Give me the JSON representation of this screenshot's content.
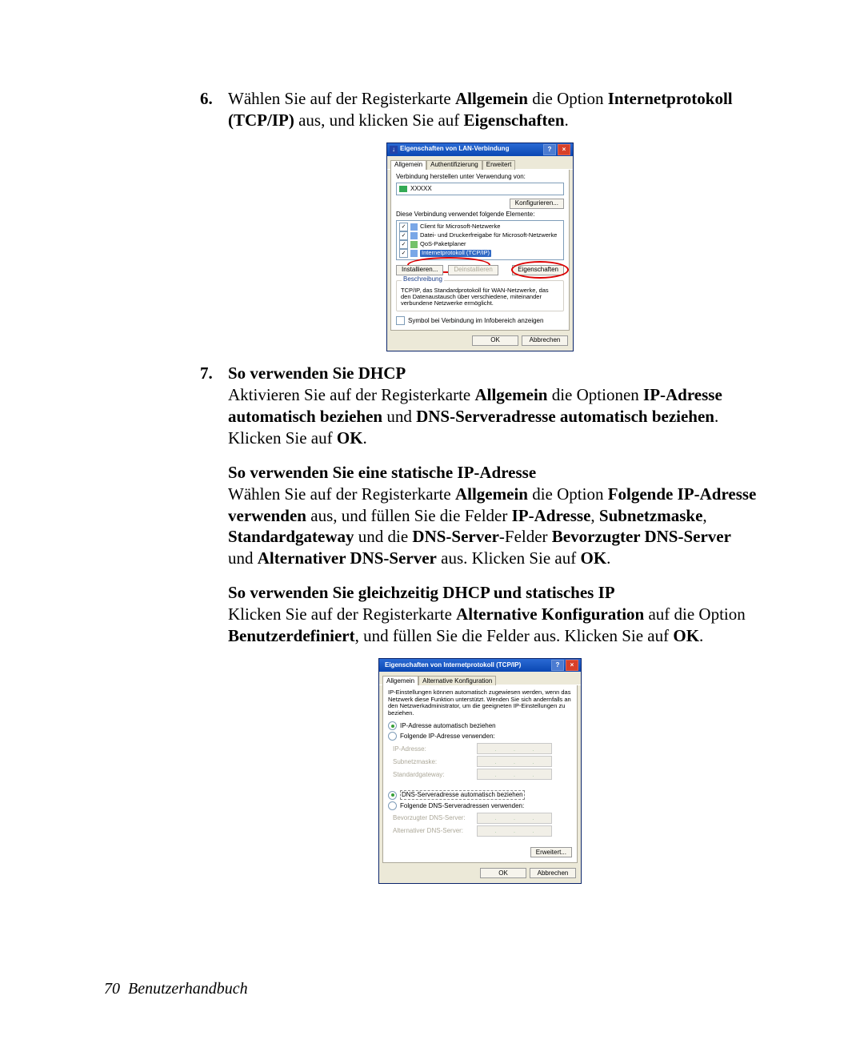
{
  "step6": {
    "num": "6.",
    "t1a": "Wählen Sie auf der Registerkarte ",
    "t1b": "Allgemein",
    "t1c": " die Option ",
    "t1d": "Internetprotokoll ",
    "t1e": "(TCP/IP)",
    "t1f": " aus, und klicken Sie auf ",
    "t1g": "Eigenschaften",
    "t1h": "."
  },
  "dlg1": {
    "title": "Eigenschaften von LAN-Verbindung",
    "tabs": [
      "Allgemein",
      "Authentifizierung",
      "Erweitert"
    ],
    "connectUsingLabel": "Verbindung herstellen unter Verwendung von:",
    "adapter": "XXXXX",
    "configureBtn": "Konfigurieren...",
    "usesLabel": "Diese Verbindung verwendet folgende Elemente:",
    "items": {
      "a": "Client für Microsoft-Netzwerke",
      "b": "Datei- und Druckerfreigabe für Microsoft-Netzwerke",
      "c": "QoS-Paketplaner",
      "d": "Internetprotokoll (TCP/IP)"
    },
    "installBtn": "Installieren...",
    "uninstallBtn": "Deinstallieren",
    "propsBtn": "Eigenschaften",
    "descGroup": "Beschreibung",
    "desc": "TCP/IP, das Standardprotokoll für WAN-Netzwerke, das den Datenaustausch über verschiedene, miteinander verbundene Netzwerke ermöglicht.",
    "showIcon": "Symbol bei Verbindung im Infobereich anzeigen",
    "ok": "OK",
    "cancel": "Abbrechen"
  },
  "step7": {
    "num": "7.",
    "heading": "So verwenden Sie DHCP",
    "t1a": "Aktivieren Sie auf der Registerkarte ",
    "t1b": "Allgemein",
    "t1c": " die Optionen ",
    "t1d": "IP-Adresse automatisch beziehen",
    "t1e": " und ",
    "t1f": "DNS-Serveradresse automatisch beziehen",
    "t1g": ". Klicken Sie auf ",
    "t1h": "OK",
    "t1i": "."
  },
  "static": {
    "heading": "So verwenden Sie eine statische IP-Adresse",
    "a": "Wählen Sie auf der Registerkarte ",
    "b": "Allgemein",
    "c": " die Option ",
    "d": "Folgende IP-Adresse verwenden",
    "e": " aus, und füllen Sie die Felder ",
    "f": "IP-Adresse",
    "g": ", ",
    "h": "Subnetzmaske",
    "i": ", ",
    "j": "Standardgateway",
    "k": " und die ",
    "l": "DNS-Server",
    "m": "-Felder ",
    "n": "Bevorzugter DNS-Server",
    "o": " und ",
    "p": "Alternativer DNS-Server",
    "q": " aus. Klicken Sie auf ",
    "r": "OK",
    "s": "."
  },
  "both": {
    "heading": "So verwenden Sie gleichzeitig DHCP und statisches IP",
    "a": "Klicken Sie auf der Registerkarte ",
    "b": "Alternative Konfiguration",
    "c": " auf die Option ",
    "d": "Benutzerdefiniert",
    "e": ", und füllen Sie die Felder aus. Klicken Sie auf ",
    "f": "OK",
    "g": "."
  },
  "dlg2": {
    "title": "Eigenschaften von Internetprotokoll (TCP/IP)",
    "tabs": [
      "Allgemein",
      "Alternative Konfiguration"
    ],
    "intro": "IP-Einstellungen können automatisch zugewiesen werden, wenn das Netzwerk diese Funktion unterstützt. Wenden Sie sich andernfalls an den Netzwerkadministrator, um die geeigneten IP-Einstellungen zu beziehen.",
    "r1": "IP-Adresse automatisch beziehen",
    "r2": "Folgende IP-Adresse verwenden:",
    "ip": "IP-Adresse:",
    "mask": "Subnetzmaske:",
    "gw": "Standardgateway:",
    "r3": "DNS-Serveradresse automatisch beziehen",
    "r4": "Folgende DNS-Serveradressen verwenden:",
    "dns1": "Bevorzugter DNS-Server:",
    "dns2": "Alternativer DNS-Server:",
    "adv": "Erweitert...",
    "ok": "OK",
    "cancel": "Abbrechen"
  },
  "footer": {
    "page": "70",
    "book": "Benutzerhandbuch"
  }
}
